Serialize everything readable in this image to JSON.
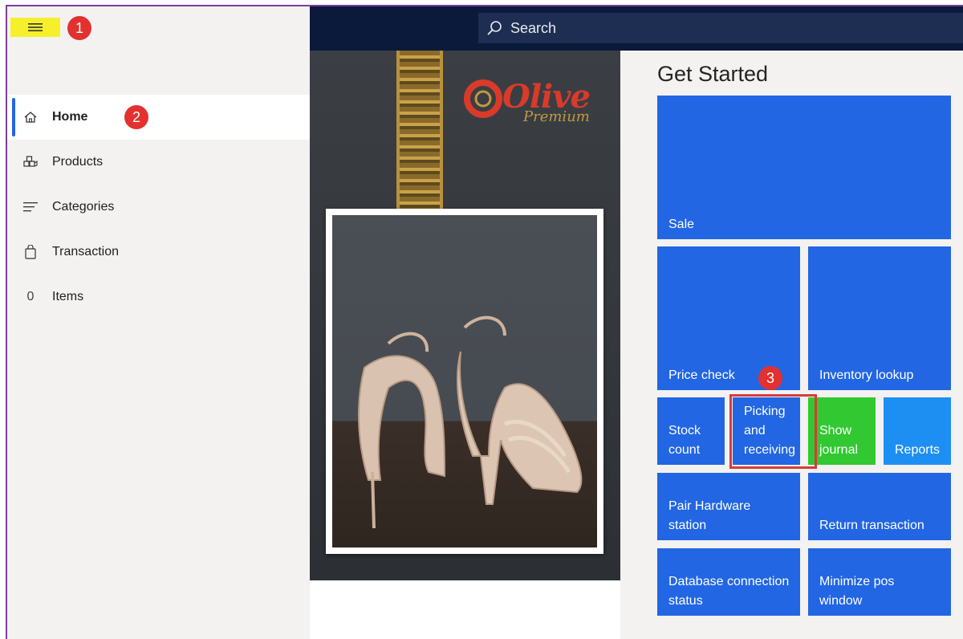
{
  "sidebar": {
    "menu_icon": "hamburger-icon",
    "items": [
      {
        "label": "Home",
        "icon": "home-icon",
        "active": true
      },
      {
        "label": "Products",
        "icon": "products-icon"
      },
      {
        "label": "Categories",
        "icon": "categories-icon"
      },
      {
        "label": "Transaction",
        "icon": "shopping-bag-icon"
      },
      {
        "label": "Items",
        "icon_text": "0"
      }
    ]
  },
  "header": {
    "search_label": "Search"
  },
  "hero": {
    "logo_text": "Olive",
    "logo_sub": "Premium"
  },
  "main": {
    "title": "Get Started",
    "tiles": {
      "sale": "Sale",
      "price_check": "Price check",
      "inventory_lookup": "Inventory lookup",
      "stock_count": "Stock count",
      "picking_receiving": "Picking and receiving",
      "show_journal": "Show journal",
      "reports": "Reports",
      "pair_hardware": "Pair Hardware station",
      "return_transaction": "Return transaction",
      "db_status": "Database connection status",
      "minimize_pos": "Minimize pos window"
    }
  },
  "annotations": {
    "callout_1": "1",
    "callout_2": "2",
    "callout_3": "3"
  },
  "colors": {
    "tile_blue": "#2266e3",
    "tile_green": "#32c832",
    "tile_light_blue": "#1e8ff2",
    "topbar": "#0b1a3a",
    "highlight_yellow": "#f5f02a",
    "callout_red": "#e2312f"
  }
}
